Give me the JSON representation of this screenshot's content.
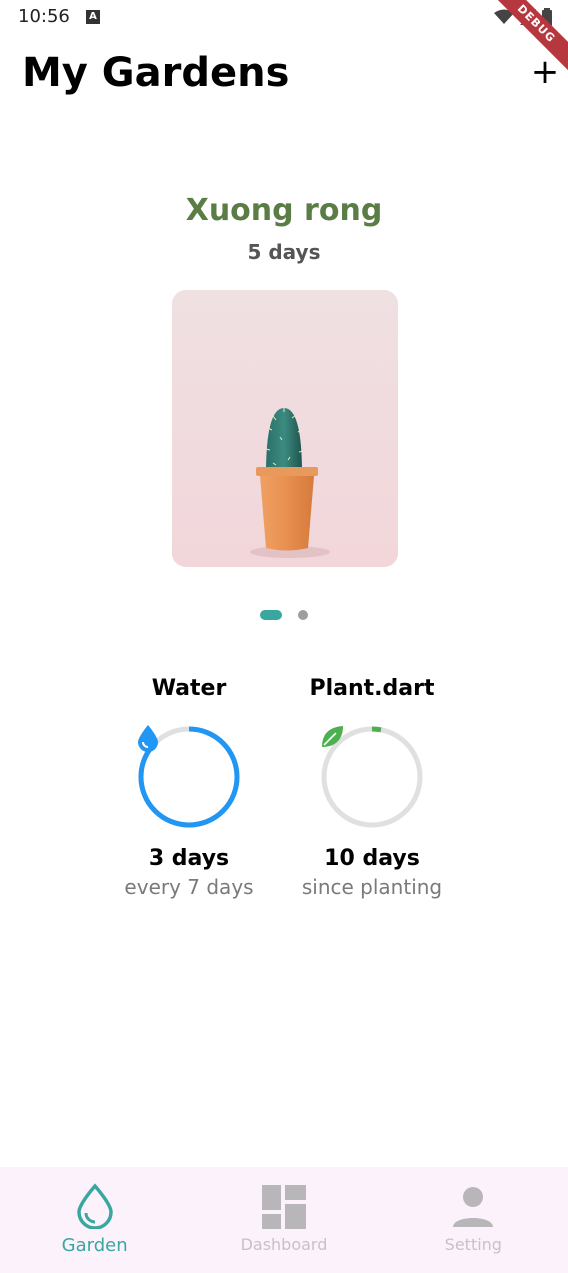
{
  "status_bar": {
    "time": "10:56",
    "badge": "A",
    "debug_label": "DEBUG"
  },
  "header": {
    "title": "My Gardens",
    "add_label": "+"
  },
  "plant": {
    "name": "Xuong rong",
    "age": "5 days"
  },
  "carousel": {
    "page_count": 2,
    "active_index": 0
  },
  "stats": {
    "water": {
      "title": "Water",
      "value": "3 days",
      "sub": "every 7 days",
      "progress": 0.86,
      "color": "#2196f3",
      "icon": "water-drop-icon"
    },
    "plant": {
      "title": "Plant.dart",
      "value": "10 days",
      "sub": "since planting",
      "progress": 0.03,
      "color": "#4caf50",
      "icon": "leaf-icon"
    }
  },
  "nav": {
    "items": [
      {
        "label": "Garden",
        "icon": "water-drop-outline-icon",
        "active": true
      },
      {
        "label": "Dashboard",
        "icon": "dashboard-icon",
        "active": false
      },
      {
        "label": "Setting",
        "icon": "person-icon",
        "active": false
      }
    ]
  },
  "colors": {
    "accent": "#3aa6a0",
    "plant_name": "#5a7c45",
    "nav_bg": "#fcf2fb"
  }
}
